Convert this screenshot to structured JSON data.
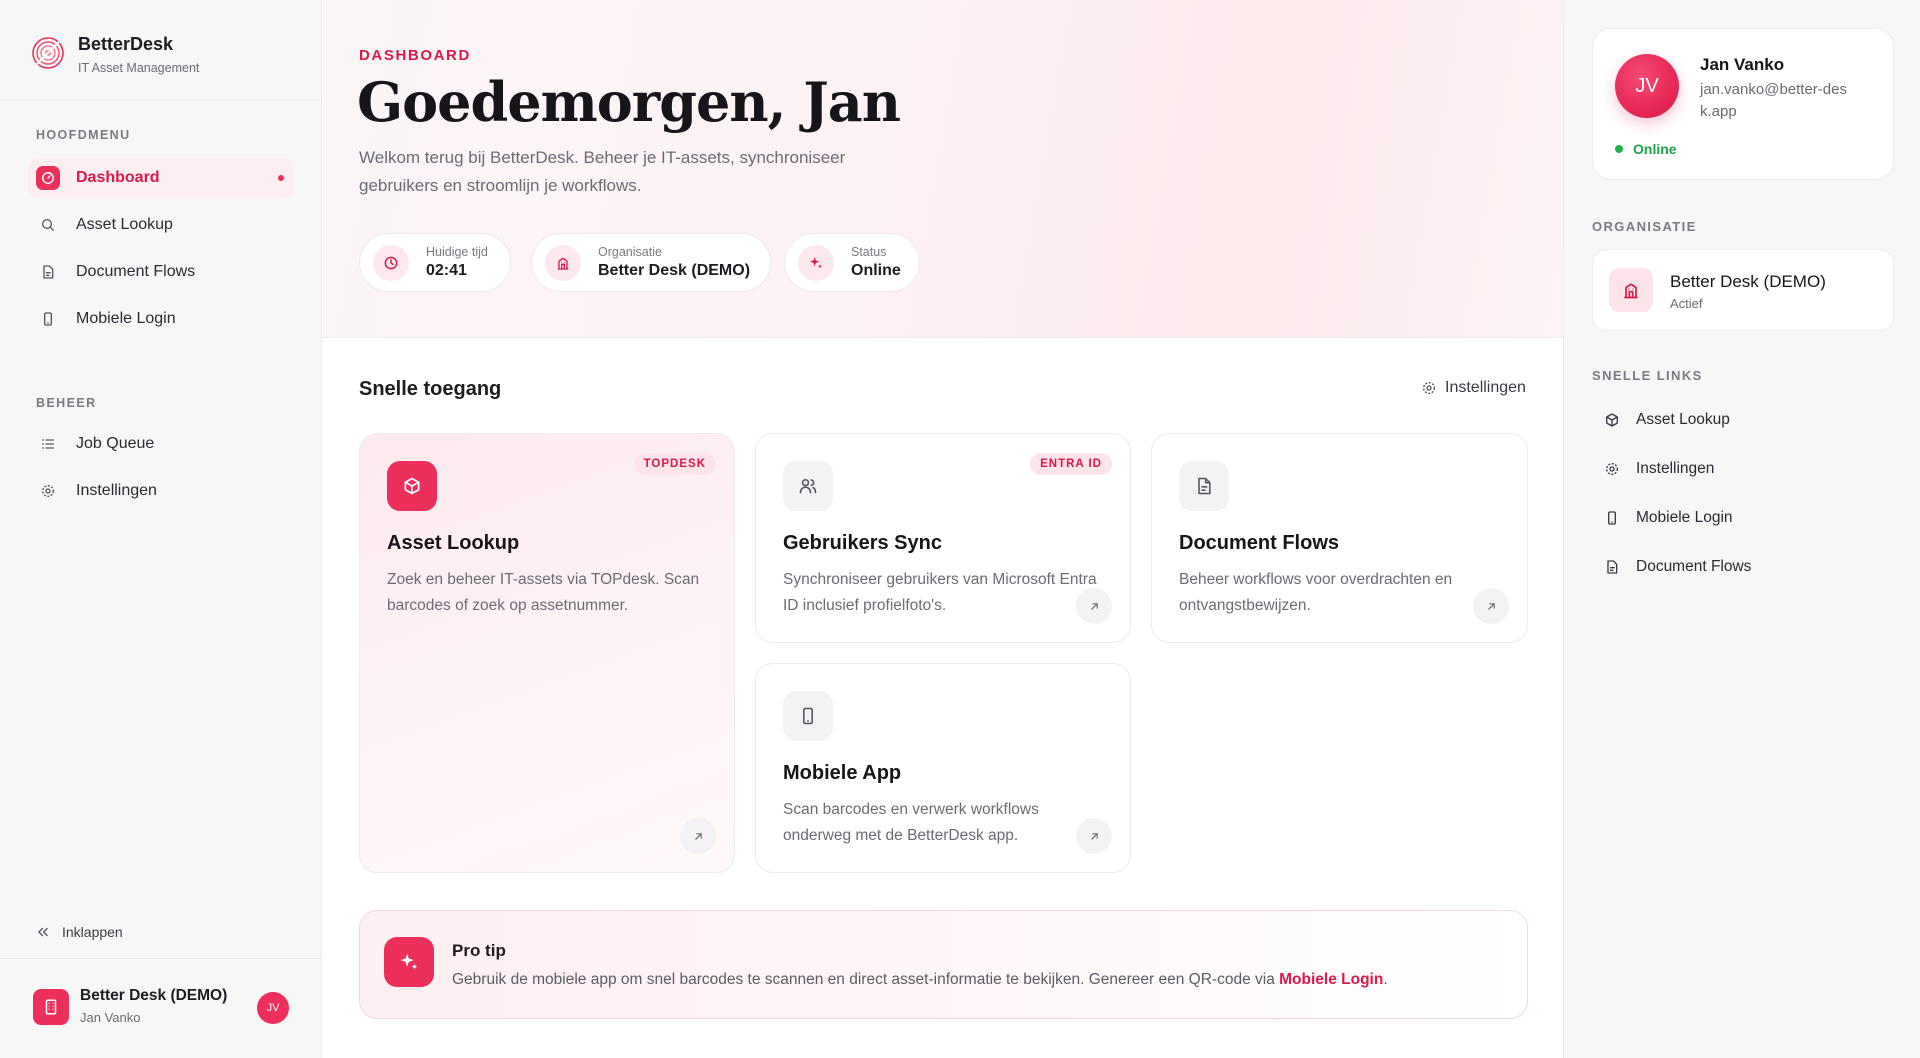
{
  "brand": {
    "name": "BetterDesk",
    "subtitle": "IT Asset Management"
  },
  "sidebar": {
    "main_section": "HOOFDMENU",
    "main_items": [
      {
        "label": "Dashboard",
        "icon": "dashboard-icon",
        "active": true
      },
      {
        "label": "Asset Lookup",
        "icon": "search-icon"
      },
      {
        "label": "Document Flows",
        "icon": "document-icon"
      },
      {
        "label": "Mobiele Login",
        "icon": "smartphone-icon"
      }
    ],
    "manage_section": "BEHEER",
    "manage_items": [
      {
        "label": "Job Queue",
        "icon": "list-icon"
      },
      {
        "label": "Instellingen",
        "icon": "gear-icon"
      }
    ],
    "collapse_label": "Inklappen",
    "footer": {
      "org": "Better Desk (DEMO)",
      "user": "Jan Vanko",
      "initials": "JV"
    }
  },
  "hero": {
    "eyebrow": "DASHBOARD",
    "greeting": "Goedemorgen,",
    "name": "Jan",
    "welcome": "Welkom terug bij BetterDesk. Beheer je IT-assets, synchroniseer gebruikers en stroomlijn je workflows.",
    "pills": [
      {
        "label": "Huidige tijd",
        "value": "02:41",
        "icon": "clock-icon"
      },
      {
        "label": "Organisatie",
        "value": "Better Desk (DEMO)",
        "icon": "building-icon"
      },
      {
        "label": "Status",
        "value": "Online",
        "icon": "sparkle-icon"
      }
    ]
  },
  "quick_access": {
    "title": "Snelle toegang",
    "settings_label": "Instellingen",
    "cards": [
      {
        "title": "Asset Lookup",
        "badge": "TOPDESK",
        "icon": "box-icon",
        "desc": "Zoek en beheer IT-assets via TOPdesk. Scan barcodes of zoek op assetnummer."
      },
      {
        "title": "Gebruikers Sync",
        "badge": "ENTRA ID",
        "icon": "users-icon",
        "desc": "Synchroniseer gebruikers van Microsoft Entra ID inclusief profielfoto's."
      },
      {
        "title": "Document Flows",
        "badge": "",
        "icon": "document-icon",
        "desc": "Beheer workflows voor overdrachten en ontvangstbewijzen."
      },
      {
        "title": "Mobiele App",
        "badge": "",
        "icon": "smartphone-icon",
        "desc": "Scan barcodes en verwerk workflows onderweg met de BetterDesk app."
      }
    ]
  },
  "protip": {
    "title": "Pro tip",
    "text": "Gebruik de mobiele app om snel barcodes te scannen en direct asset-informatie te bekijken. Genereer een QR-code via",
    "link": "Mobiele Login",
    "suffix": "."
  },
  "right_panel": {
    "profile": {
      "initials": "JV",
      "name": "Jan Vanko",
      "email": "jan.vanko@better-desk.app",
      "status": "Online"
    },
    "org_section": "ORGANISATIE",
    "org": {
      "name": "Better Desk (DEMO)",
      "status": "Actief"
    },
    "links_section": "SNELLE LINKS",
    "links": [
      {
        "label": "Asset Lookup",
        "icon": "box-icon"
      },
      {
        "label": "Instellingen",
        "icon": "gear-icon"
      },
      {
        "label": "Mobiele Login",
        "icon": "smartphone-icon"
      },
      {
        "label": "Document Flows",
        "icon": "document-icon"
      }
    ]
  },
  "colors": {
    "accent": "#ec2f5b",
    "accent_text": "#d81b4a",
    "online": "#1fb34f",
    "sidebar_bg": "#f7f7f8"
  }
}
